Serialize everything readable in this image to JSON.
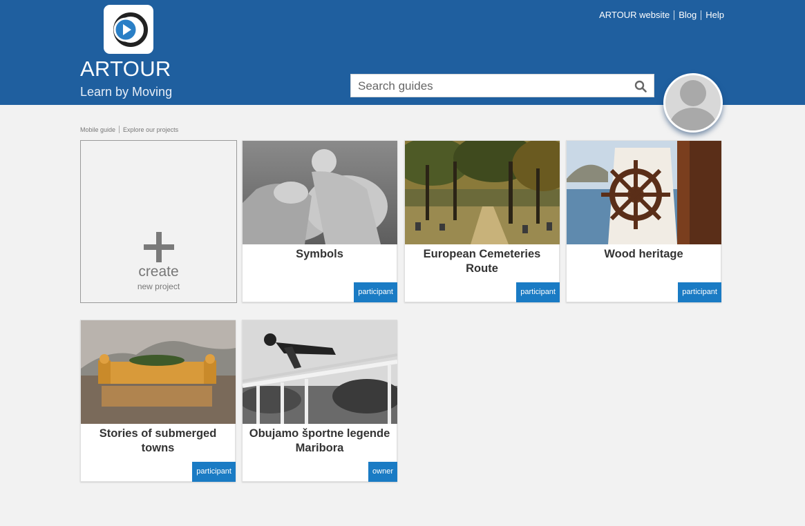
{
  "header": {
    "brand_name": "ARTOUR",
    "tagline": "Learn by Moving",
    "links": [
      "ARTOUR website",
      "Blog",
      "Help"
    ],
    "brand_color": "#1f5f9f"
  },
  "search": {
    "placeholder": "Search guides",
    "value": ""
  },
  "breadcrumb": [
    "Mobile guide",
    "Explore our projects"
  ],
  "create_card": {
    "label": "create",
    "sublabel": "new project"
  },
  "projects": [
    {
      "title": "Symbols",
      "role": "participant"
    },
    {
      "title": "European Cemeteries Route",
      "role": "participant"
    },
    {
      "title": "Wood heritage",
      "role": "participant"
    },
    {
      "title": "Stories of submerged towns",
      "role": "participant"
    },
    {
      "title": "Obujamo športne legende Maribora",
      "role": "owner"
    }
  ],
  "colors": {
    "role_badge": "#1a7bc4",
    "page_background": "#f2f2f2"
  },
  "icons": {
    "logo": "play-circle-logo-icon",
    "search": "search-icon",
    "avatar": "user-silhouette-icon",
    "create": "plus-icon"
  }
}
